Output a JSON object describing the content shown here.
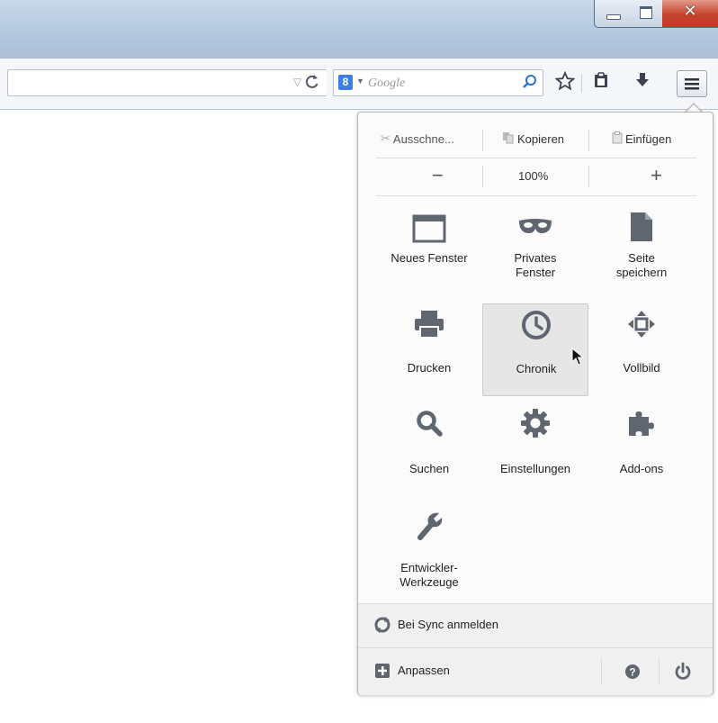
{
  "window": {
    "controls": {
      "minimize": "minimize",
      "maximize": "maximize",
      "close": "x"
    }
  },
  "navbar": {
    "reload_glyph": "C",
    "search": {
      "engine_letter": "8",
      "placeholder": "Google"
    }
  },
  "menu": {
    "edit": {
      "cut": "Ausschne...",
      "copy": "Kopieren",
      "paste": "Einfügen"
    },
    "zoom": {
      "out": "−",
      "level": "100%",
      "in": "+"
    },
    "tiles": [
      {
        "label": "Neues Fenster",
        "icon": "window-icon"
      },
      {
        "label": "Privates Fenster",
        "icon": "mask-icon"
      },
      {
        "label": "Seite speichern",
        "icon": "page-icon"
      },
      {
        "label": "Drucken",
        "icon": "printer-icon"
      },
      {
        "label": "Chronik",
        "icon": "clock-icon"
      },
      {
        "label": "Vollbild",
        "icon": "fullscreen-icon"
      },
      {
        "label": "Suchen",
        "icon": "magnifier-icon"
      },
      {
        "label": "Einstellungen",
        "icon": "gear-icon"
      },
      {
        "label": "Add-ons",
        "icon": "puzzle-icon"
      },
      {
        "label": "Entwickler-Werkzeuge",
        "icon": "wrench-icon"
      }
    ],
    "sync_label": "Bei Sync anmelden",
    "customize_label": "Anpassen"
  },
  "colors": {
    "titlebar": "#b8cae0",
    "close_button": "#c6432c",
    "icon_gray": "#5f6670",
    "hover_tile": "#e6e6e6"
  }
}
